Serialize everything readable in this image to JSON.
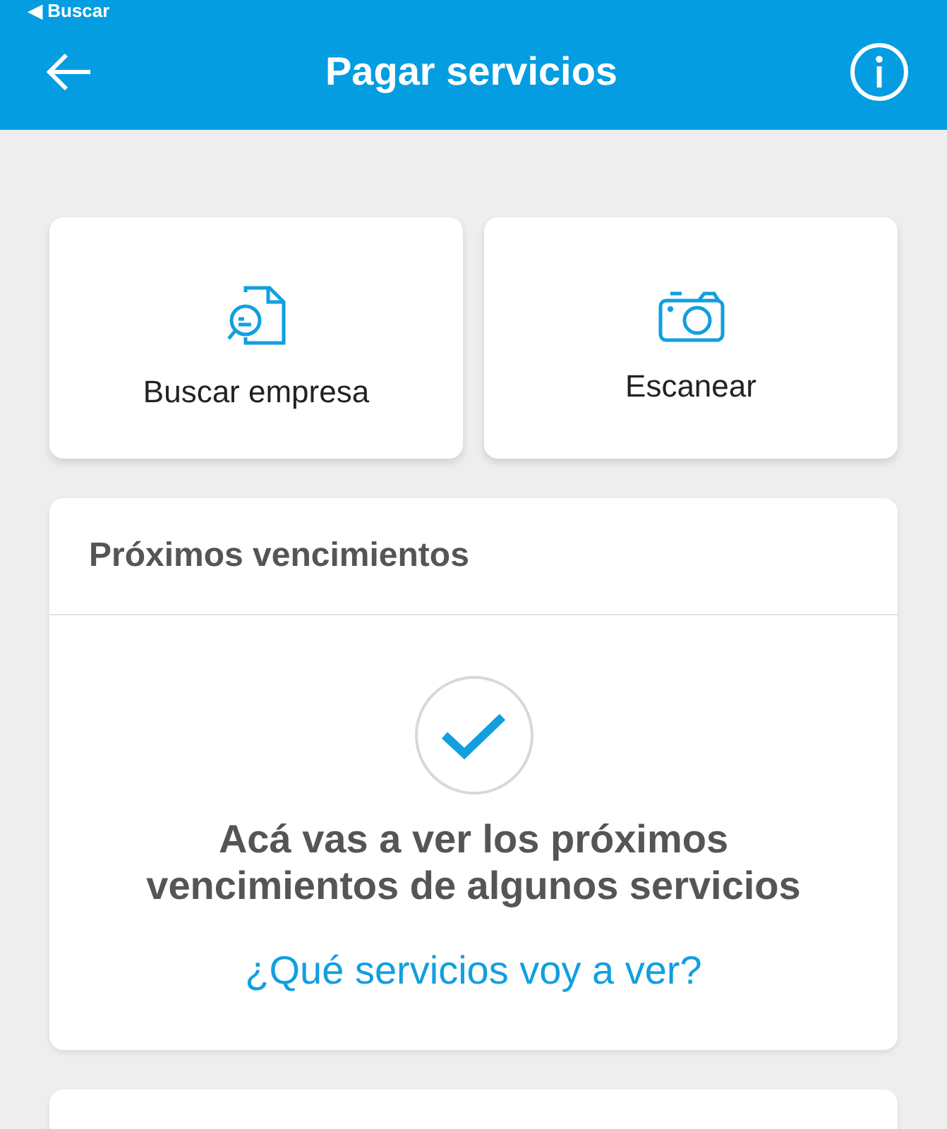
{
  "status_bar": {
    "back_label": "◀ Buscar"
  },
  "header": {
    "title": "Pagar servicios"
  },
  "actions": [
    {
      "label": "Buscar empresa",
      "kind": "search"
    },
    {
      "label": "Escanear",
      "kind": "camera"
    }
  ],
  "upcoming": {
    "title": "Próximos vencimientos",
    "message": "Acá vas a ver los próximos vencimientos de algunos servicios",
    "link": "¿Qué servicios voy a ver?"
  }
}
